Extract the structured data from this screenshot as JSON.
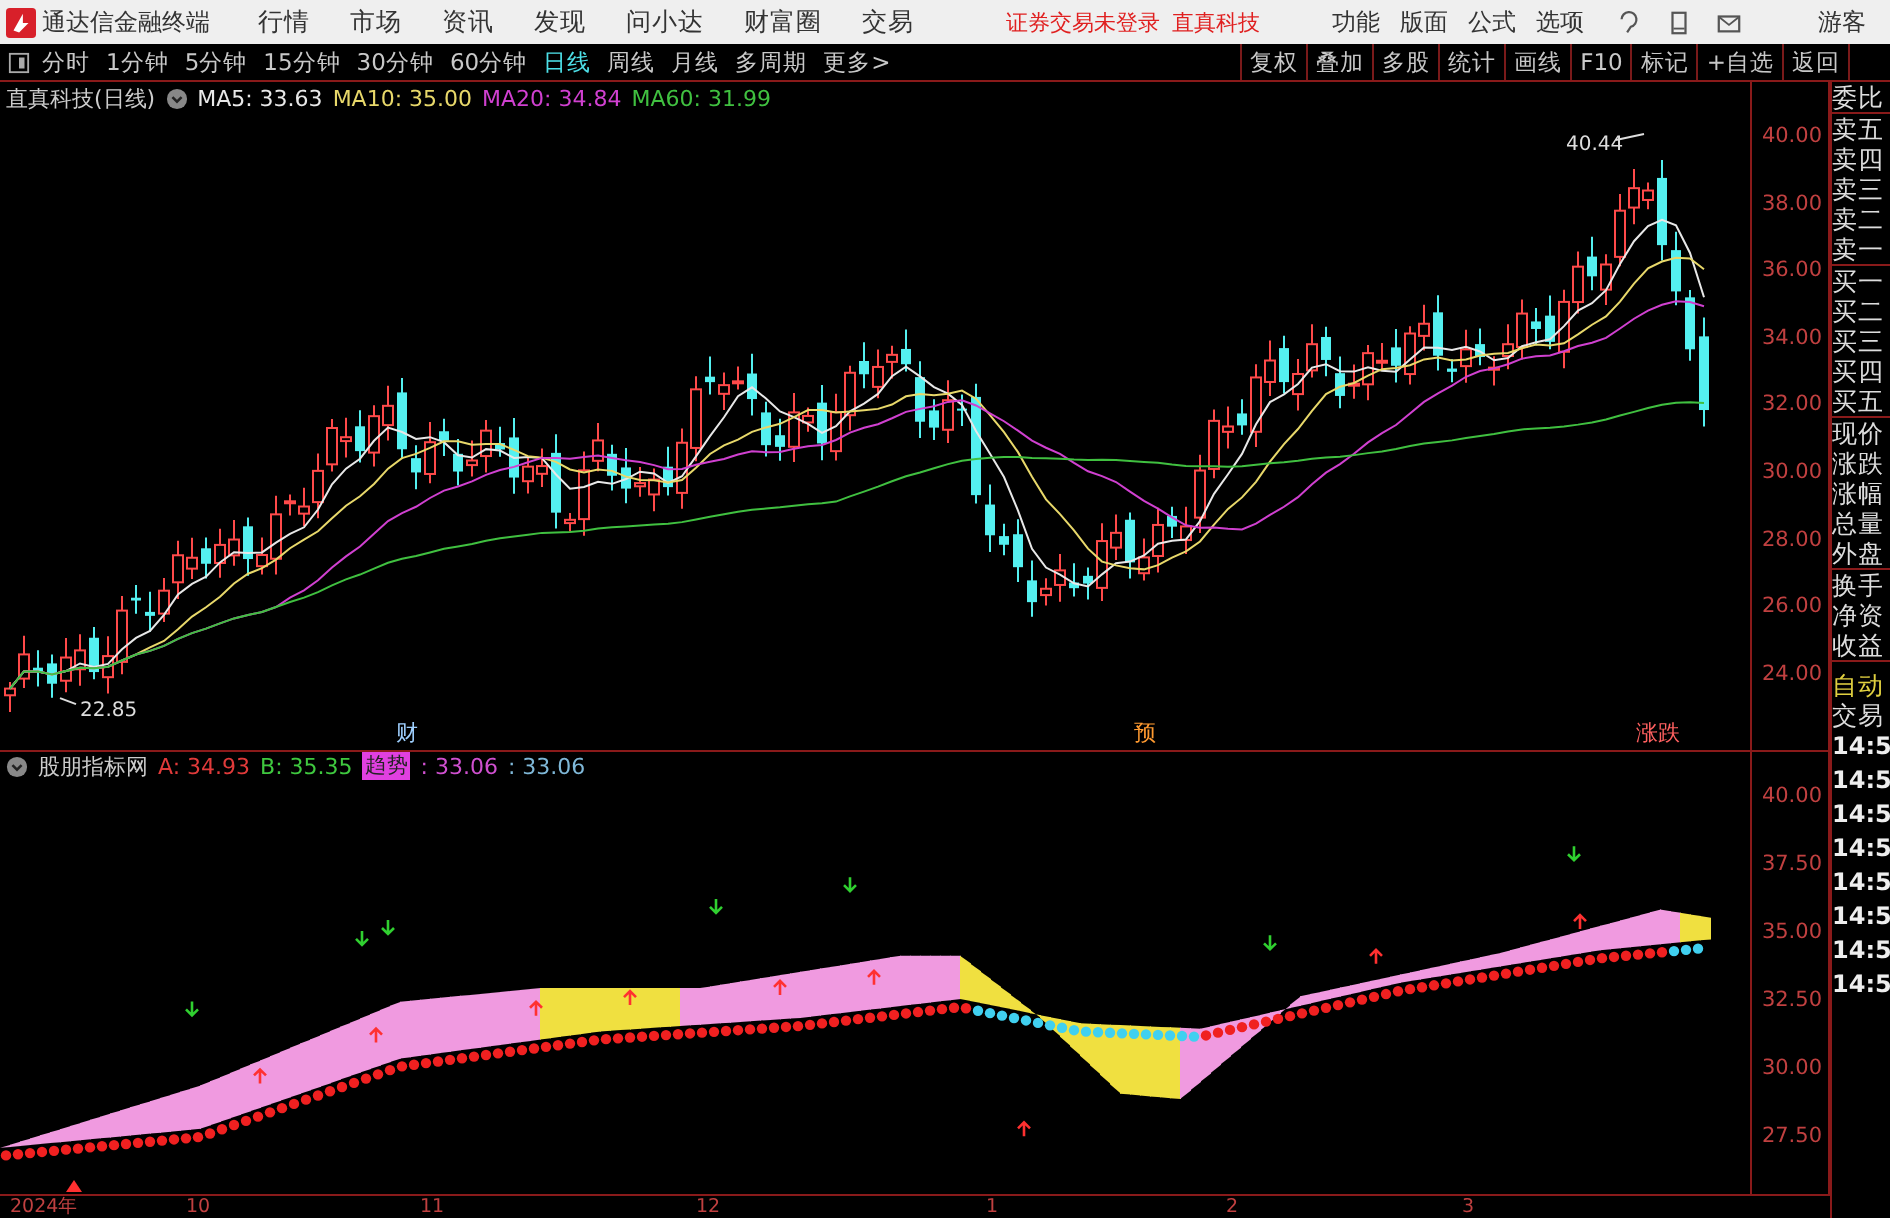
{
  "app": {
    "title": "通达信金融终端"
  },
  "menu": [
    "行情",
    "市场",
    "资讯",
    "发现",
    "问小达",
    "财富圈",
    "交易"
  ],
  "login_status": "证券交易未登录",
  "stock_link": "直真科技",
  "tools": [
    "功能",
    "版面",
    "公式",
    "选项"
  ],
  "user": "游客",
  "periods": [
    {
      "label": "分时",
      "selected": false
    },
    {
      "label": "1分钟",
      "selected": false
    },
    {
      "label": "5分钟",
      "selected": false
    },
    {
      "label": "15分钟",
      "selected": false
    },
    {
      "label": "30分钟",
      "selected": false
    },
    {
      "label": "60分钟",
      "selected": false
    },
    {
      "label": "日线",
      "selected": true
    },
    {
      "label": "周线",
      "selected": false
    },
    {
      "label": "月线",
      "selected": false
    },
    {
      "label": "多周期",
      "selected": false
    },
    {
      "label": "更多>",
      "selected": false
    }
  ],
  "actions": [
    "复权",
    "叠加",
    "多股",
    "统计",
    "画线",
    "F10",
    "标记",
    "+自选",
    "返回"
  ],
  "price_chart": {
    "title": "直真科技(日线)",
    "ma": [
      {
        "label": "MA5: 33.63",
        "color": "#e8e8e8"
      },
      {
        "label": "MA10: 35.00",
        "color": "#e8d86a"
      },
      {
        "label": "MA20: 34.84",
        "color": "#d040d0"
      },
      {
        "label": "MA60: 31.99",
        "color": "#40c040"
      }
    ],
    "axis": [
      "40.00",
      "38.00",
      "36.00",
      "34.00",
      "32.00",
      "30.00",
      "28.00",
      "26.00",
      "24.00"
    ],
    "high_label": "40.44",
    "low_label": "22.85",
    "events": [
      {
        "label": "财",
        "color": "#9fd0ff"
      },
      {
        "label": "预",
        "color": "#ff9a30"
      },
      {
        "label": "涨跌",
        "color": "#ff6060"
      }
    ]
  },
  "indicator": {
    "title": "股朋指标网",
    "values": [
      {
        "kind": "value",
        "label": "A: 34.93",
        "color": "#e03a3a"
      },
      {
        "kind": "value",
        "label": "B: 35.35",
        "color": "#3fc83f"
      },
      {
        "kind": "badge",
        "label": "趋势",
        "color": "#e040e0"
      },
      {
        "kind": "value",
        "label": ": 33.06",
        "color": "#d050d0"
      },
      {
        "kind": "value",
        "label": ": 33.06",
        "color": "#7fb8d8"
      }
    ],
    "axis": [
      "40.00",
      "37.50",
      "35.00",
      "32.50",
      "30.00",
      "27.50"
    ]
  },
  "x_axis": [
    "2024年",
    "10",
    "11",
    "12",
    "1",
    "2",
    "3"
  ],
  "quote_panel": {
    "groups": [
      [
        "委比"
      ],
      [
        "卖五",
        "卖四",
        "卖三",
        "卖二",
        "卖一"
      ],
      [
        "买一",
        "买二",
        "买三",
        "买四",
        "买五"
      ],
      [
        "现价",
        "涨跌",
        "涨幅",
        "总量",
        "外盘"
      ],
      [
        "换手",
        "净资",
        "收益"
      ]
    ],
    "auto": "自动",
    "trade": "交易",
    "times": [
      "14:5",
      "14:5",
      "14:5",
      "14:5",
      "14:5",
      "14:5",
      "14:5",
      "14:5"
    ]
  }
}
